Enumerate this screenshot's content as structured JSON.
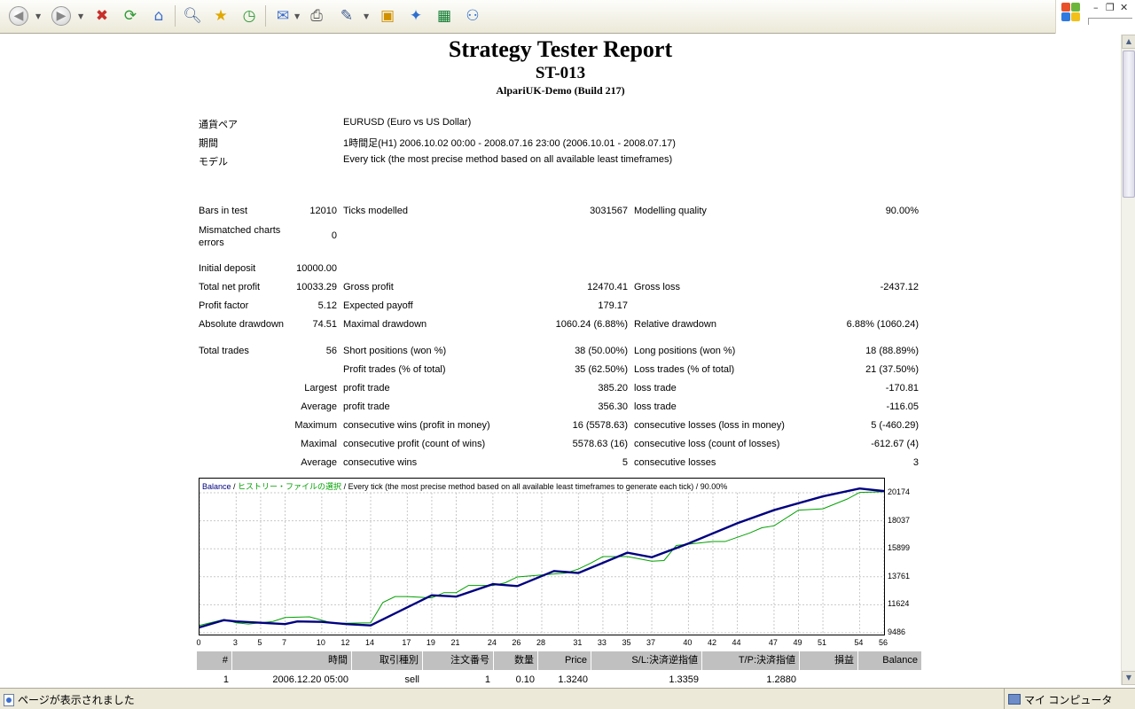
{
  "status": {
    "left_text": "ページが表示されました",
    "right_text": "マイ コンピュータ"
  },
  "report": {
    "title": "Strategy Tester Report",
    "expert": "ST-013",
    "server": "AlpariUK-Demo (Build 217)"
  },
  "info": [
    {
      "label": "通貨ペア",
      "value": "EURUSD (Euro vs US Dollar)"
    },
    {
      "label": "期間",
      "value": "1時間足(H1) 2006.10.02 00:00 - 2008.07.16 23:00 (2006.10.01 - 2008.07.17)"
    },
    {
      "label": "モデル",
      "value": "Every tick (the most precise method based on all available least timeframes)"
    }
  ],
  "stats": {
    "bars_label": "Bars in test",
    "bars": "12010",
    "ticks_label": "Ticks modelled",
    "ticks": "3031567",
    "quality_label": "Modelling quality",
    "quality": "90.00%",
    "mismatch_label": "Mismatched charts errors",
    "mismatch": "0",
    "deposit_label": "Initial deposit",
    "deposit": "10000.00",
    "net_label": "Total net profit",
    "net": "10033.29",
    "gp_label": "Gross profit",
    "gp": "12470.41",
    "gl_label": "Gross loss",
    "gl": "-2437.12",
    "pf_label": "Profit factor",
    "pf": "5.12",
    "ep_label": "Expected payoff",
    "ep": "179.17",
    "ad_label": "Absolute drawdown",
    "ad": "74.51",
    "md_label": "Maximal drawdown",
    "md": "1060.24 (6.88%)",
    "rd_label": "Relative drawdown",
    "rd": "6.88% (1060.24)",
    "tt_label": "Total trades",
    "tt": "56",
    "sp_label": "Short positions (won %)",
    "sp": "38 (50.00%)",
    "lp_label": "Long positions (won %)",
    "lp": "18 (88.89%)",
    "pt_label": "Profit trades (% of total)",
    "pt": "35 (62.50%)",
    "lt_label": "Loss trades (% of total)",
    "lt": "21 (37.50%)",
    "largest": "Largest",
    "avg": "Average",
    "maximum": "Maximum",
    "maximal": "Maximal",
    "average2": "Average",
    "lpt_label": "profit trade",
    "lpt": "385.20",
    "llt_label": "loss trade",
    "llt": "-170.81",
    "apt_label": "profit trade",
    "apt": "356.30",
    "alt_label": "loss trade",
    "alt": "-116.05",
    "mcw_label": "consecutive wins (profit in money)",
    "mcw": "16 (5578.63)",
    "mcl_label": "consecutive losses (loss in money)",
    "mcl": "5 (-460.29)",
    "mcp_label": "consecutive profit (count of wins)",
    "mcp": "5578.63 (16)",
    "mcll_label": "consecutive loss (count of losses)",
    "mcll": "-612.67 (4)",
    "acw_label": "consecutive wins",
    "acw": "5",
    "acl_label": "consecutive losses",
    "acl": "3"
  },
  "chart_data": {
    "type": "line",
    "title_parts": [
      "Balance",
      " / ",
      "ヒストリー・ファイルの選択",
      " / Every tick (the most precise method based on all available least timeframes to generate each tick) / 90.00%"
    ],
    "x_ticks": [
      "0",
      "3",
      "5",
      "7",
      "10",
      "12",
      "14",
      "17",
      "19",
      "21",
      "24",
      "26",
      "28",
      "31",
      "33",
      "35",
      "37",
      "40",
      "42",
      "44",
      "47",
      "49",
      "51",
      "54",
      "56"
    ],
    "y_ticks": [
      "20174",
      "18037",
      "15899",
      "13761",
      "11624",
      "9486"
    ],
    "xlim": [
      0,
      56
    ],
    "ylim": [
      9486,
      20174
    ],
    "series": [
      {
        "name": "Balance",
        "color": "#000080",
        "x": [
          0,
          2,
          3,
          5,
          7,
          8,
          10,
          12,
          14,
          19,
          21,
          24,
          26,
          29,
          31,
          35,
          37,
          40,
          44,
          47,
          51,
          54,
          56
        ],
        "y": [
          9900,
          10450,
          10350,
          10250,
          10150,
          10350,
          10320,
          10150,
          10050,
          12350,
          12250,
          13200,
          13050,
          14200,
          14050,
          15600,
          15250,
          16300,
          17850,
          18850,
          19900,
          20500,
          20300
        ]
      },
      {
        "name": "Equity",
        "color": "#00a000",
        "x": [
          0,
          2,
          3,
          4,
          6,
          7,
          9,
          11,
          14,
          15,
          16,
          17,
          19,
          20,
          21,
          22,
          24,
          25,
          26,
          28,
          30,
          31,
          32,
          33,
          35,
          37,
          38,
          39,
          42,
          43,
          45,
          46,
          47,
          49,
          51,
          53,
          54,
          56
        ],
        "y": [
          10050,
          10500,
          10250,
          10150,
          10350,
          10650,
          10700,
          10200,
          10250,
          11800,
          12250,
          12250,
          12150,
          12550,
          12550,
          13100,
          13100,
          13300,
          13750,
          13900,
          14050,
          14350,
          14800,
          15300,
          15300,
          14950,
          15000,
          16150,
          16450,
          16450,
          17100,
          17500,
          17650,
          18850,
          18950,
          19700,
          20200,
          20250
        ]
      }
    ]
  },
  "trades": {
    "headers": [
      "#",
      "時間",
      "取引種別",
      "注文番号",
      "数量",
      "Price",
      "S/L:決済逆指値",
      "T/P:決済指値",
      "損益",
      "Balance"
    ],
    "rows": [
      [
        "1",
        "2006.12.20 05:00",
        "sell",
        "1",
        "0.10",
        "1.3240",
        "1.3359",
        "1.2880",
        "",
        ""
      ]
    ]
  }
}
